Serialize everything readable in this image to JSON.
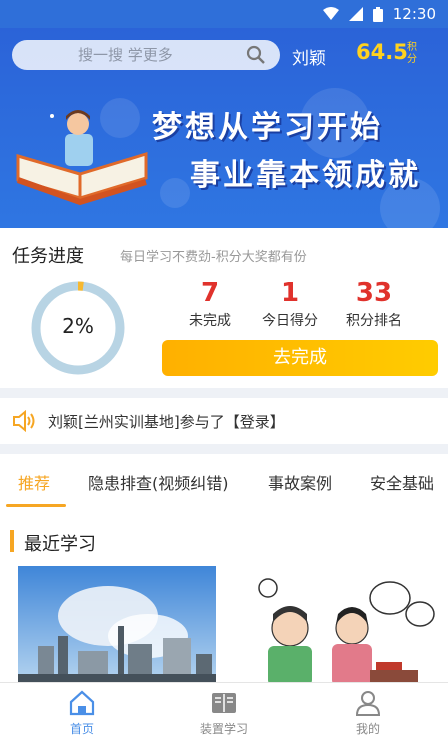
{
  "status_bar": {
    "time": "12:30"
  },
  "header": {
    "search_placeholder": "搜一搜 学更多",
    "username": "刘颖",
    "score": "64.5",
    "score_unit": "积分"
  },
  "banner": {
    "line1": "梦想从学习开始",
    "line2": "事业靠本领成就"
  },
  "task": {
    "title": "任务进度",
    "subtitle": "每日学习不费劲-积分大奖都有份",
    "progress_percent": 2,
    "progress_label": "2%",
    "stats": [
      {
        "value": "7",
        "label": "未完成"
      },
      {
        "value": "1",
        "label": "今日得分"
      },
      {
        "value": "33",
        "label": "积分排名"
      }
    ],
    "button_label": "去完成"
  },
  "notice": {
    "text": "刘颖[兰州实训基地]参与了【登录】"
  },
  "tabs": [
    {
      "label": "推荐",
      "active": true
    },
    {
      "label": "隐患排查(视频纠错)",
      "active": false
    },
    {
      "label": "事故案例",
      "active": false
    },
    {
      "label": "安全基础",
      "active": false
    }
  ],
  "recent": {
    "title": "最近学习"
  },
  "bottom_nav": [
    {
      "label": "首页",
      "icon": "home-icon",
      "active": true
    },
    {
      "label": "装置学习",
      "icon": "book-icon",
      "active": false
    },
    {
      "label": "我的",
      "icon": "user-icon",
      "active": false
    }
  ],
  "colors": {
    "primary": "#2f6fd9",
    "accent": "#f6a623",
    "stat_red": "#e0322c",
    "progress": "#b8d4e4",
    "progress_fill": "#f6b830"
  }
}
